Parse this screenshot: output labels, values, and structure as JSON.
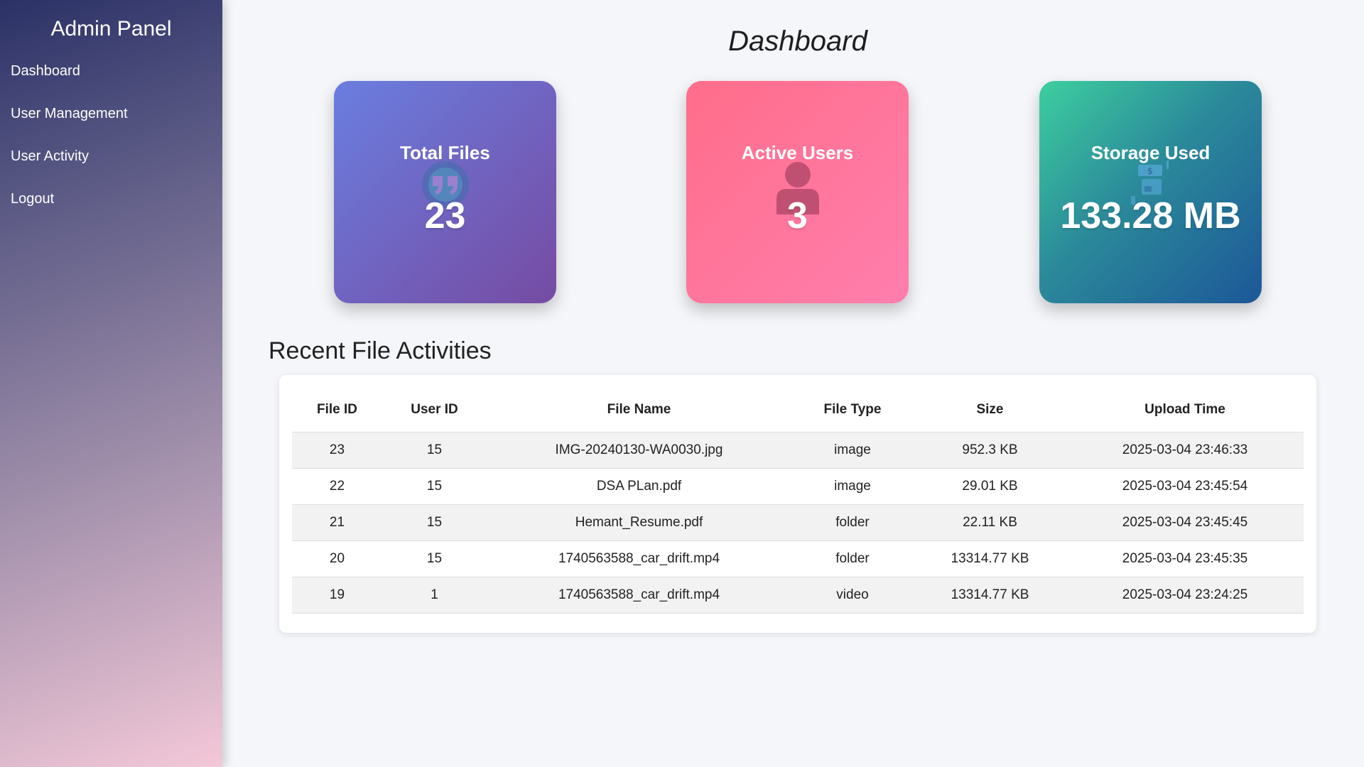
{
  "sidebar": {
    "title": "Admin Panel",
    "items": [
      {
        "label": "Dashboard"
      },
      {
        "label": "User Management"
      },
      {
        "label": "User Activity"
      },
      {
        "label": "Logout"
      }
    ]
  },
  "main": {
    "title": "Dashboard",
    "cards": [
      {
        "label": "Total Files",
        "value": "23",
        "icon": "quote-icon"
      },
      {
        "label": "Active Users",
        "value": "3",
        "icon": "user-icon"
      },
      {
        "label": "Storage Used",
        "value": "133.28 MB",
        "icon": "storage-boxes-icon"
      }
    ],
    "activities": {
      "title": "Recent File Activities",
      "columns": [
        "File ID",
        "User ID",
        "File Name",
        "File Type",
        "Size",
        "Upload Time"
      ],
      "rows": [
        [
          "23",
          "15",
          "IMG-20240130-WA0030.jpg",
          "image",
          "952.3 KB",
          "2025-03-04 23:46:33"
        ],
        [
          "22",
          "15",
          "DSA PLan.pdf",
          "image",
          "29.01 KB",
          "2025-03-04 23:45:54"
        ],
        [
          "21",
          "15",
          "Hemant_Resume.pdf",
          "folder",
          "22.11 KB",
          "2025-03-04 23:45:45"
        ],
        [
          "20",
          "15",
          "1740563588_car_drift.mp4",
          "folder",
          "13314.77 KB",
          "2025-03-04 23:45:35"
        ],
        [
          "19",
          "1",
          "1740563588_car_drift.mp4",
          "video",
          "13314.77 KB",
          "2025-03-04 23:24:25"
        ]
      ]
    }
  }
}
